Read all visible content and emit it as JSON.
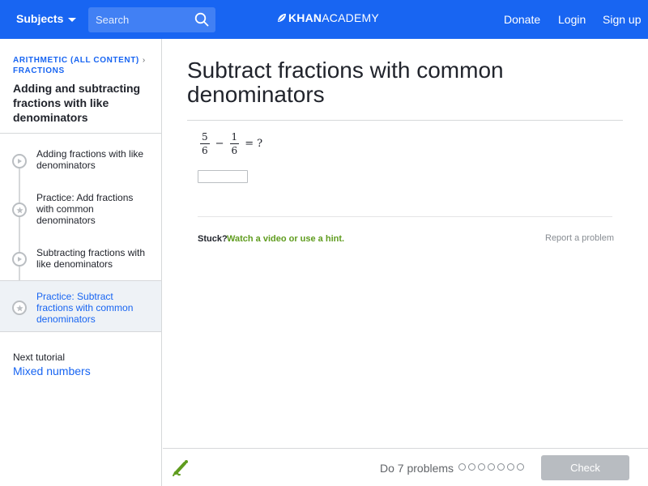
{
  "header": {
    "subjects_label": "Subjects",
    "search_placeholder": "Search",
    "logo_bold": "KHAN",
    "logo_light": "ACADEMY",
    "donate_label": "Donate",
    "login_label": "Login",
    "signup_label": "Sign up",
    "bg_color": "#1865f2"
  },
  "sidebar": {
    "breadcrumb_1": "ARITHMETIC (ALL CONTENT)",
    "breadcrumb_2": "FRACTIONS",
    "tutorial_title": "Adding and subtracting fractions with like denominators",
    "items": [
      {
        "label": "Adding fractions with like denominators",
        "icon": "play-icon",
        "active": false
      },
      {
        "label": "Practice: Add fractions with common denominators",
        "icon": "star-icon",
        "active": false
      },
      {
        "label": "Subtracting fractions with like denominators",
        "icon": "play-icon",
        "active": false
      },
      {
        "label": "Practice: Subtract fractions with common denominators",
        "icon": "star-icon",
        "active": true
      }
    ],
    "next_label": "Next tutorial",
    "next_link": "Mixed numbers"
  },
  "main": {
    "title": "Subtract fractions with common denominators",
    "problem": {
      "a_num": "5",
      "a_den": "6",
      "minus": "−",
      "b_num": "1",
      "b_den": "6",
      "equals": "=",
      "question": "?"
    },
    "answer_value": "",
    "stuck_label": "Stuck?",
    "hint_label": "Watch a video or use a hint.",
    "report_label": "Report a problem"
  },
  "footer": {
    "do_label": "Do 7 problems",
    "problem_count": 7,
    "check_label": "Check"
  },
  "colors": {
    "accent_blue": "#1865f2",
    "hint_green": "#5f9c1e",
    "check_disabled": "#b8bcc1"
  }
}
